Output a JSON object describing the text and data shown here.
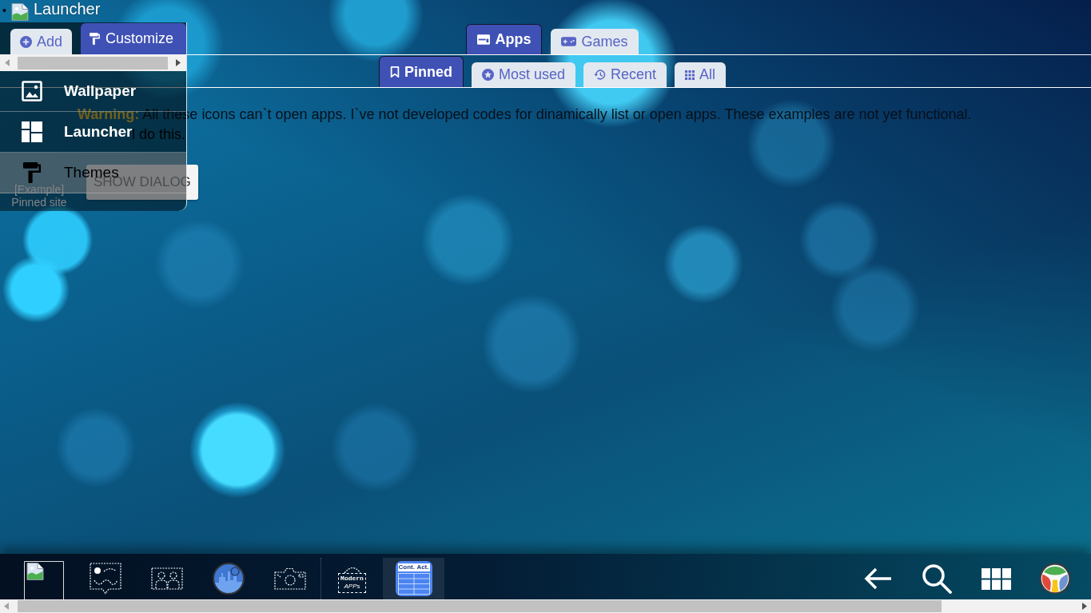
{
  "header": {
    "bullet": "•",
    "title": "Launcher"
  },
  "side_panel": {
    "tabs": [
      {
        "label": "Add",
        "kind": "add",
        "selected": false
      },
      {
        "label": "Customize",
        "kind": "customize",
        "selected": true
      }
    ],
    "menu": [
      {
        "label": "Wallpaper",
        "kind": "wallpaper",
        "selected": false
      },
      {
        "label": "Launcher",
        "kind": "launcher",
        "selected": false
      },
      {
        "label": "Themes",
        "kind": "themes",
        "selected": true
      }
    ]
  },
  "section_tabs": [
    {
      "label": "Apps",
      "kind": "apps",
      "selected": true
    },
    {
      "label": "Games",
      "kind": "games",
      "selected": false
    }
  ],
  "filter_tabs": [
    {
      "label": "Pinned",
      "kind": "pinned",
      "selected": true
    },
    {
      "label": "Most used",
      "kind": "most_used",
      "selected": false
    },
    {
      "label": "Recent",
      "kind": "recent",
      "selected": false
    },
    {
      "label": "All",
      "kind": "all",
      "selected": false
    }
  ],
  "content": {
    "pinned_site": {
      "label": "[Example] Pinned site"
    },
    "warning": {
      "label": "Warning:",
      "text": "All these icons can`t open apps. I`ve not developed codes for dinamically list or open apps. These examples are not yet functional.",
      "continuation": "l do this."
    },
    "dialog_button": "SHOW DIALOG"
  },
  "taskbar": {
    "groups": [
      {
        "apps": [
          {
            "kind": "broken_image",
            "selected": false
          },
          {
            "kind": "picture_message",
            "selected": false
          },
          {
            "kind": "people",
            "selected": false
          },
          {
            "kind": "city_logo",
            "selected": false
          },
          {
            "kind": "camera",
            "selected": false
          }
        ]
      },
      {
        "apps": [
          {
            "kind": "sign",
            "texts": [
              "Modern",
              "APPs"
            ],
            "selected": false
          },
          {
            "kind": "table",
            "texts": [
              "Cont.",
              "Act."
            ],
            "selected": true
          }
        ]
      }
    ],
    "actions": [
      {
        "kind": "back"
      },
      {
        "kind": "search"
      },
      {
        "kind": "grid"
      },
      {
        "kind": "color_logo"
      }
    ]
  }
}
